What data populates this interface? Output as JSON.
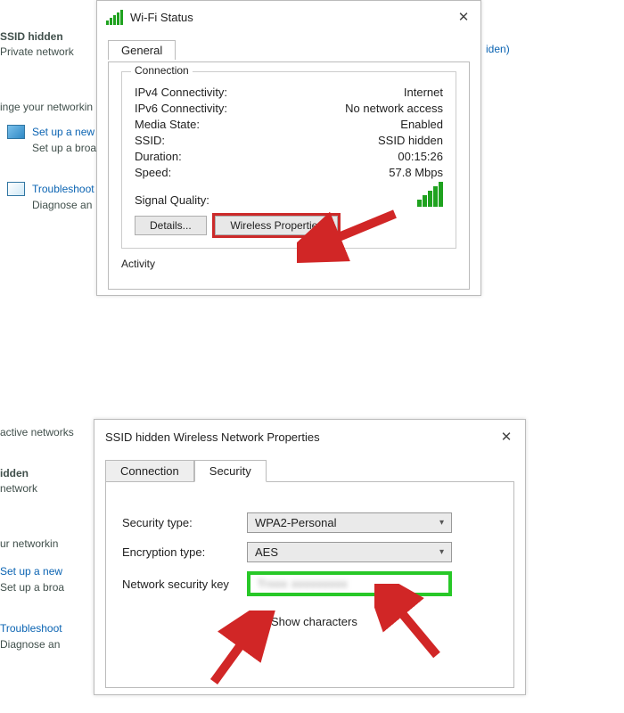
{
  "bg1": {
    "ssid_hidden": "SSID hidden",
    "private_network": "Private network",
    "change_net": "inge your networkin",
    "setup_link": "Set up a new",
    "setup_text": "Set up a broa",
    "troubleshoot_link": "Troubleshoot",
    "diagnose_text": "Diagnose an",
    "right_text": "iden)"
  },
  "dialog1": {
    "title": "Wi-Fi Status",
    "tab_general": "General",
    "group_connection": "Connection",
    "ipv4_label": "IPv4 Connectivity:",
    "ipv4_value": "Internet",
    "ipv6_label": "IPv6 Connectivity:",
    "ipv6_value": "No network access",
    "media_label": "Media State:",
    "media_value": "Enabled",
    "ssid_label": "SSID:",
    "ssid_value": "SSID hidden",
    "duration_label": "Duration:",
    "duration_value": "00:15:26",
    "speed_label": "Speed:",
    "speed_value": "57.8 Mbps",
    "signal_label": "Signal Quality:",
    "btn_details": "Details...",
    "btn_wireless": "Wireless Properties",
    "group_activity": "Activity"
  },
  "bg2": {
    "active_networks": "active networks",
    "idden": "idden",
    "network": "network",
    "ur_net": "ur networkin",
    "setup_link": "Set up a new",
    "setup_text": "Set up a broa",
    "troubleshoot_link": "Troubleshoot",
    "diagnose_text": "Diagnose an"
  },
  "dialog2": {
    "title": "SSID hidden Wireless Network Properties",
    "tab_connection": "Connection",
    "tab_security": "Security",
    "sec_type_label": "Security type:",
    "sec_type_value": "WPA2-Personal",
    "enc_type_label": "Encryption type:",
    "enc_type_value": "AES",
    "key_label": "Network security key",
    "key_value": "Trxxx xxxxxxxxx",
    "show_chars": "Show characters"
  }
}
